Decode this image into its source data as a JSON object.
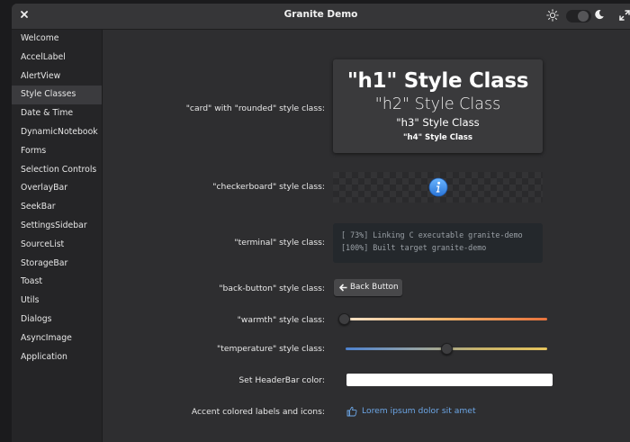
{
  "window": {
    "title": "Granite Demo",
    "icons": {
      "close": "close-icon",
      "style": "sun-icon",
      "dark": "moon-icon",
      "maximize": "maximize-icon"
    },
    "dark_mode_switch": {
      "state": "on"
    }
  },
  "sidebar": {
    "selected": "Style Classes",
    "items": [
      "Welcome",
      "AccelLabel",
      "AlertView",
      "Style Classes",
      "Date & Time",
      "DynamicNotebook",
      "Forms",
      "Selection Controls",
      "OverlayBar",
      "SeekBar",
      "SettingsSidebar",
      "SourceList",
      "StorageBar",
      "Toast",
      "Utils",
      "Dialogs",
      "AsyncImage",
      "Application"
    ]
  },
  "main": {
    "card_label": "\"card\" with \"rounded\" style class:",
    "card": {
      "h1": "\"h1\" Style Class",
      "h2": "\"h2\" Style Class",
      "h3": "\"h3\" Style Class",
      "h4": "\"h4\" Style Class"
    },
    "checkerboard_label": "\"checkerboard\" style class:",
    "checkerboard_icon": "info-icon",
    "terminal_label": "\"terminal\" style class:",
    "terminal_lines": [
      "[ 73%] Linking C executable granite-demo",
      "[100%] Built target granite-demo"
    ],
    "back_button_label": "\"back-button\" style class:",
    "back_button_text": "Back Button",
    "warmth_label": "\"warmth\" style class:",
    "warmth_value": 0.0,
    "temperature_label": "\"temperature\" style class:",
    "temperature_value": 0.5,
    "headerbar_color_label": "Set HeaderBar color:",
    "headerbar_color_value": "#ffffff",
    "accent_label": "Accent colored labels and icons:",
    "accent_text": "Lorem ipsum dolor sit amet",
    "accent_icon": "thumbs-up-icon",
    "accent_color": "#6ca6e6"
  }
}
